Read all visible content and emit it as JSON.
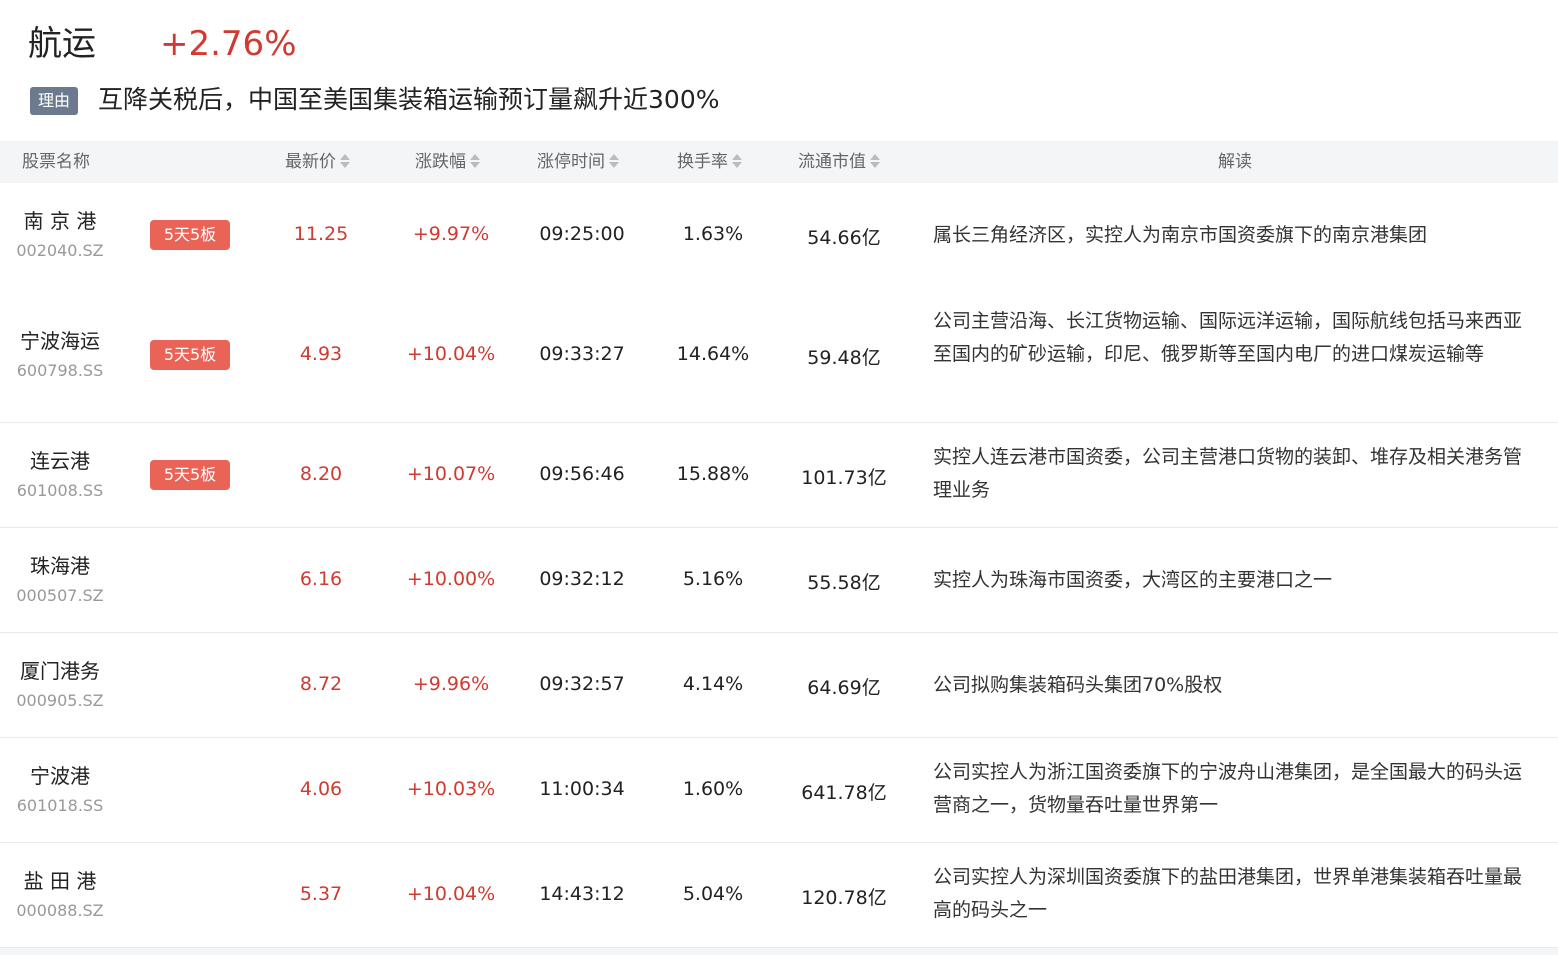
{
  "header": {
    "sector_name": "航运",
    "sector_change": "+2.76%",
    "reason_tag": "理由",
    "reason_text": "互降关税后，中国至美国集装箱运输预订量飙升近300%"
  },
  "columns": {
    "name": "股票名称",
    "price": "最新价",
    "change": "涨跌幅",
    "limit_time": "涨停时间",
    "turnover": "换手率",
    "market_cap": "流通市值",
    "interpretation": "解读"
  },
  "rows": [
    {
      "name": "南 京 港",
      "code": "002040.SZ",
      "badge": "5天5板",
      "price": "11.25",
      "change": "+9.97%",
      "time": "09:25:00",
      "turnover": "1.63%",
      "cap": "54.66亿",
      "interp": "属长三角经济区，实控人为南京市国资委旗下的南京港集团"
    },
    {
      "name": "宁波海运",
      "code": "600798.SS",
      "badge": "5天5板",
      "price": "4.93",
      "change": "+10.04%",
      "time": "09:33:27",
      "turnover": "14.64%",
      "cap": "59.48亿",
      "interp": "公司主营沿海、长江货物运输、国际远洋运输，国际航线包括马来西亚至国内的矿砂运输，印尼、俄罗斯等至国内电厂的进口煤炭运输等"
    },
    {
      "name": "连云港",
      "code": "601008.SS",
      "badge": "5天5板",
      "price": "8.20",
      "change": "+10.07%",
      "time": "09:56:46",
      "turnover": "15.88%",
      "cap": "101.73亿",
      "interp": "实控人连云港市国资委，公司主营港口货物的装卸、堆存及相关港务管理业务"
    },
    {
      "name": "珠海港",
      "code": "000507.SZ",
      "badge": "",
      "price": "6.16",
      "change": "+10.00%",
      "time": "09:32:12",
      "turnover": "5.16%",
      "cap": "55.58亿",
      "interp": "实控人为珠海市国资委，大湾区的主要港口之一"
    },
    {
      "name": "厦门港务",
      "code": "000905.SZ",
      "badge": "",
      "price": "8.72",
      "change": "+9.96%",
      "time": "09:32:57",
      "turnover": "4.14%",
      "cap": "64.69亿",
      "interp": "公司拟购集装箱码头集团70%股权"
    },
    {
      "name": "宁波港",
      "code": "601018.SS",
      "badge": "",
      "price": "4.06",
      "change": "+10.03%",
      "time": "11:00:34",
      "turnover": "1.60%",
      "cap": "641.78亿",
      "interp": "公司实控人为浙江国资委旗下的宁波舟山港集团，是全国最大的码头运营商之一，货物量吞吐量世界第一"
    },
    {
      "name": "盐 田 港",
      "code": "000088.SZ",
      "badge": "",
      "price": "5.37",
      "change": "+10.04%",
      "time": "14:43:12",
      "turnover": "5.04%",
      "cap": "120.78亿",
      "interp": "公司实控人为深圳国资委旗下的盐田港集团，世界单港集装箱吞吐量最高的码头之一"
    }
  ]
}
